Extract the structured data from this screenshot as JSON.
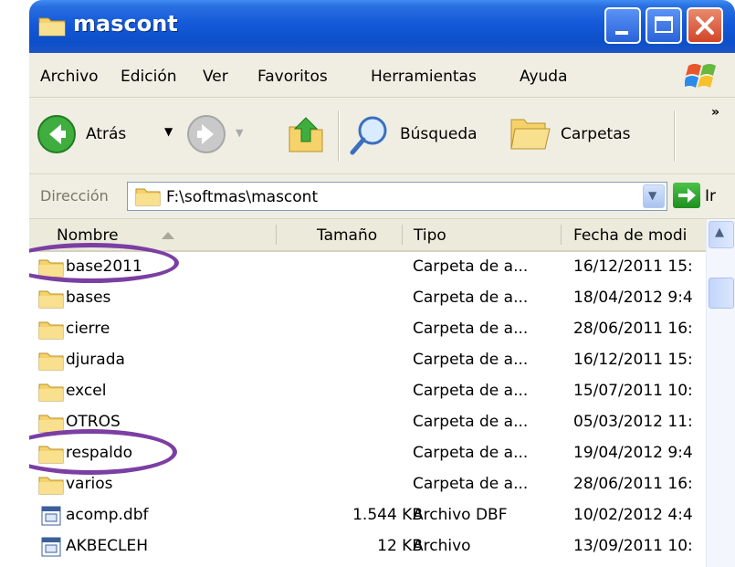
{
  "window": {
    "title": "mascont"
  },
  "menu": [
    "Archivo",
    "Edición",
    "Ver",
    "Favoritos",
    "Herramientas",
    "Ayuda"
  ],
  "toolbar": {
    "back_label": "Atrás",
    "search_label": "Búsqueda",
    "folders_label": "Carpetas",
    "overflow": "»"
  },
  "address": {
    "label": "Dirección",
    "path": "F:\\softmas\\mascont",
    "go_label": "Ir"
  },
  "columns": {
    "name": "Nombre",
    "size": "Tamaño",
    "type": "Tipo",
    "date": "Fecha de modi"
  },
  "files": [
    {
      "name": "base2011",
      "size": "",
      "type": "Carpeta de a...",
      "date": "16/12/2011 15:",
      "icon": "folder-icon"
    },
    {
      "name": "bases",
      "size": "",
      "type": "Carpeta de a...",
      "date": "18/04/2012 9:4",
      "icon": "folder-icon"
    },
    {
      "name": "cierre",
      "size": "",
      "type": "Carpeta de a...",
      "date": "28/06/2011 16:",
      "icon": "folder-icon"
    },
    {
      "name": "djurada",
      "size": "",
      "type": "Carpeta de a...",
      "date": "16/12/2011 15:",
      "icon": "folder-icon"
    },
    {
      "name": "excel",
      "size": "",
      "type": "Carpeta de a...",
      "date": "15/07/2011 10:",
      "icon": "folder-icon"
    },
    {
      "name": "OTROS",
      "size": "",
      "type": "Carpeta de a...",
      "date": "05/03/2012 11:",
      "icon": "folder-icon"
    },
    {
      "name": "respaldo",
      "size": "",
      "type": "Carpeta de a...",
      "date": "19/04/2012 9:4",
      "icon": "folder-icon"
    },
    {
      "name": "varios",
      "size": "",
      "type": "Carpeta de a...",
      "date": "28/06/2011 16:",
      "icon": "folder-icon"
    },
    {
      "name": "acomp.dbf",
      "size": "1.544 KB",
      "type": "Archivo DBF",
      "date": "10/02/2012 4:4",
      "icon": "dbf-file-icon"
    },
    {
      "name": "AKBECLEH",
      "size": "12 KB",
      "type": "Archivo",
      "date": "13/09/2011 10:",
      "icon": "dbf-file-icon"
    },
    {
      "name": "",
      "size": "",
      "type": "",
      "date": "",
      "icon": "file-icon"
    }
  ],
  "colors": {
    "title_bar": "#0d4fc9",
    "annotation": "#7b3fa3",
    "folder": "#f5d26a"
  }
}
